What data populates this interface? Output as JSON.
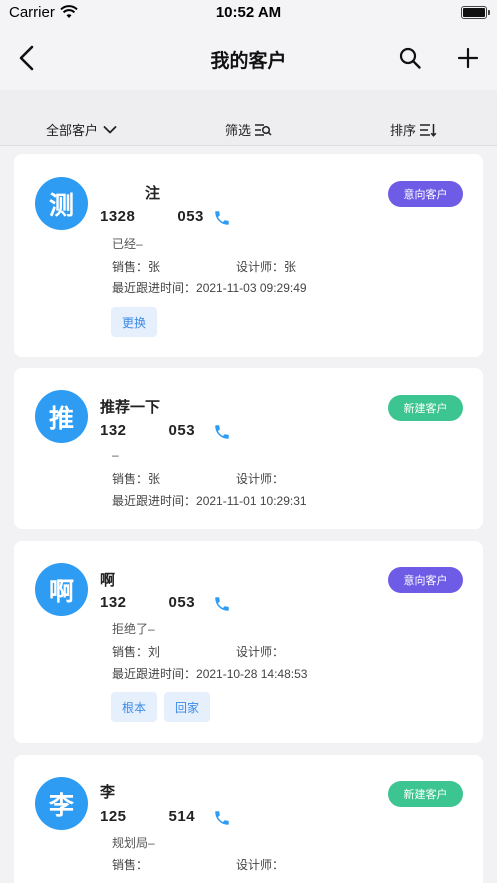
{
  "status_bar": {
    "carrier": "Carrier",
    "time": "10:52 AM"
  },
  "nav": {
    "title": "我的客户"
  },
  "filters": {
    "all": "全部客户",
    "screen": "筛选",
    "sort": "排序"
  },
  "labels": {
    "sales": "销售：",
    "designer": "设计师：",
    "last_follow": "最近跟进时间："
  },
  "customers": [
    {
      "avatar": "测",
      "name": "注",
      "phone_a": "1328",
      "phone_b": "053",
      "note": "已经–",
      "sales": "张",
      "designer": "张",
      "last_follow": "2021-11-03 09:29:49",
      "status": "意向客户",
      "status_color": "#6f5ce6",
      "tags": [
        "更换"
      ]
    },
    {
      "avatar": "推",
      "name": "推荐一下",
      "phone_a": "132",
      "phone_b": "053",
      "note": "–",
      "sales": "张",
      "designer": "",
      "last_follow": "2021-11-01 10:29:31",
      "status": "新建客户",
      "status_color": "#3cc590",
      "tags": []
    },
    {
      "avatar": "啊",
      "name": "啊",
      "phone_a": "132",
      "phone_b": "053",
      "note": "拒绝了–",
      "sales": "刘",
      "designer": "",
      "last_follow": "2021-10-28 14:48:53",
      "status": "意向客户",
      "status_color": "#6f5ce6",
      "tags": [
        "根本",
        "回家"
      ]
    },
    {
      "avatar": "李",
      "name": "李",
      "phone_a": "125",
      "phone_b": "514",
      "note": "规划局–",
      "sales": "",
      "designer": "",
      "last_follow": "",
      "status": "新建客户",
      "status_color": "#3cc590",
      "tags": []
    }
  ]
}
